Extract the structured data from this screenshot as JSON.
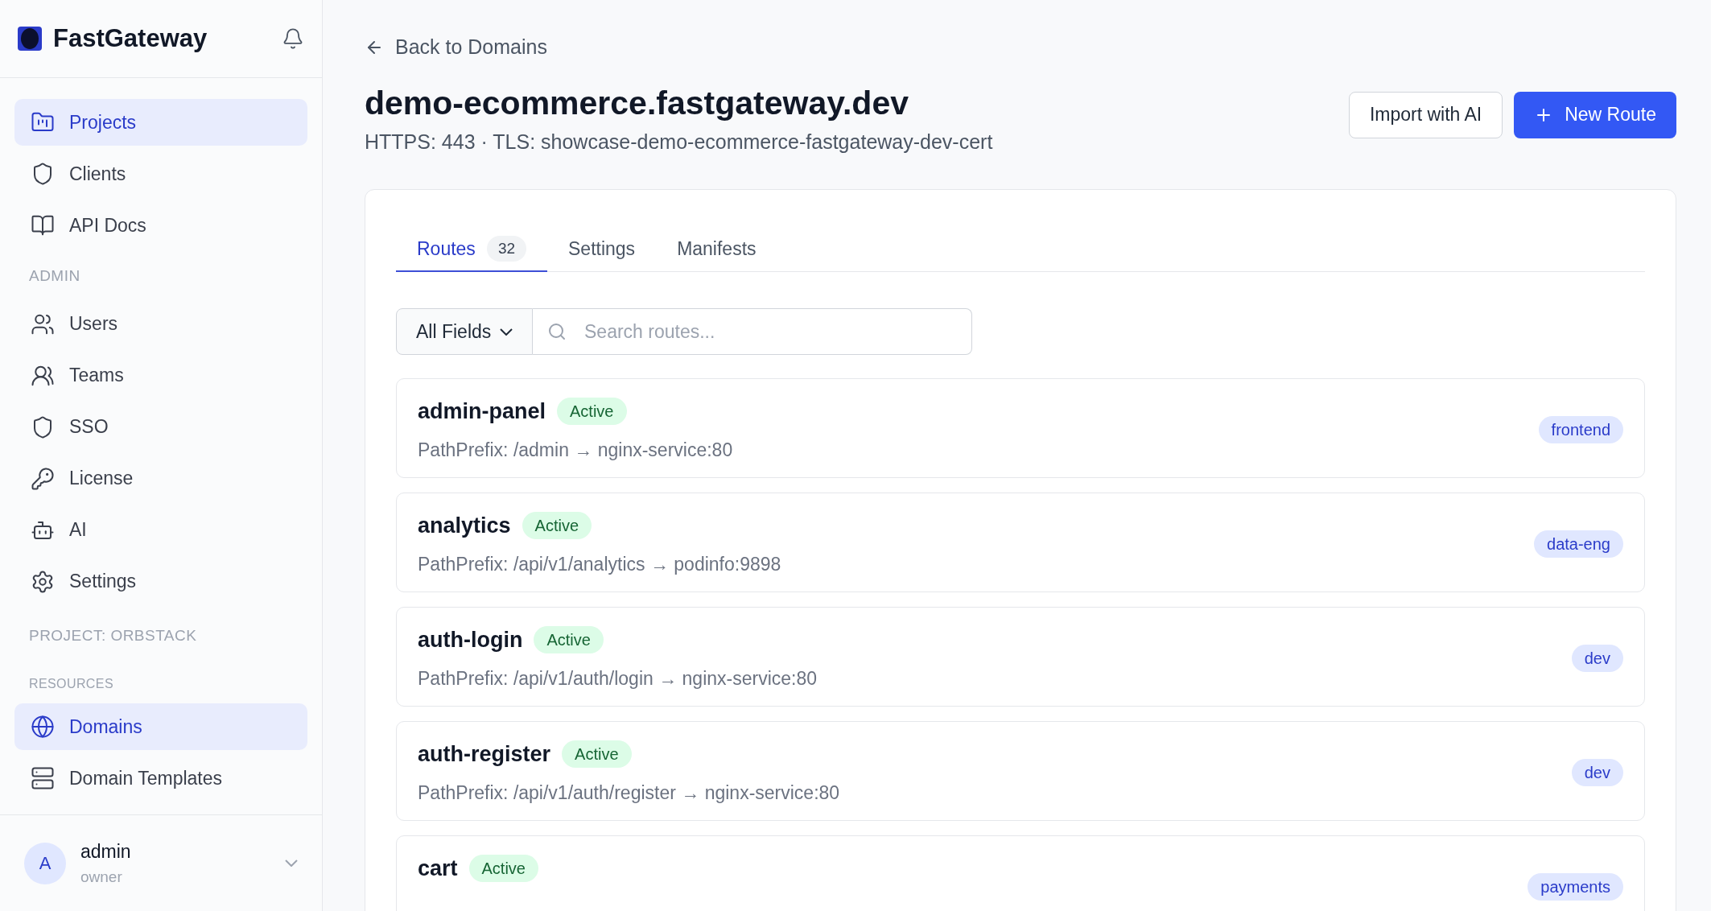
{
  "sidebar": {
    "brand": "FastGateway",
    "nav": [
      {
        "label": "Projects",
        "selected": true
      },
      {
        "label": "Clients",
        "selected": false
      },
      {
        "label": "API Docs",
        "selected": false
      }
    ],
    "admin": {
      "heading": "ADMIN",
      "items": [
        {
          "label": "Users",
          "selected": false
        },
        {
          "label": "Teams",
          "selected": false
        },
        {
          "label": "SSO",
          "selected": false
        },
        {
          "label": "License",
          "selected": false
        },
        {
          "label": "AI",
          "selected": false
        },
        {
          "label": "Settings",
          "selected": false
        }
      ]
    },
    "project": {
      "heading": "PROJECT: ORBSTACK",
      "subheading": "RESOURCES",
      "items": [
        {
          "label": "Domains",
          "selected": true
        },
        {
          "label": "Domain Templates",
          "selected": false
        }
      ]
    },
    "user": {
      "initial": "A",
      "name": "admin",
      "role": "owner"
    }
  },
  "back_link": "Back to Domains",
  "title": "demo-ecommerce.fastgateway.dev",
  "subtitle": "HTTPS: 443 · TLS: showcase-demo-ecommerce-fastgateway-dev-cert",
  "buttons": {
    "import": "Import with AI",
    "new": "New Route"
  },
  "tabs": [
    {
      "label": "Routes",
      "count": "32",
      "selected": true
    },
    {
      "label": "Settings",
      "selected": false
    },
    {
      "label": "Manifests",
      "selected": false
    }
  ],
  "filter": {
    "field": "All Fields",
    "placeholder": "Search routes..."
  },
  "routes": [
    {
      "name": "admin-panel",
      "status": "Active",
      "rule": "PathPrefix: /admin → nginx-service:80",
      "tag": "frontend"
    },
    {
      "name": "analytics",
      "status": "Active",
      "rule": "PathPrefix: /api/v1/analytics → podinfo:9898",
      "tag": "data-eng"
    },
    {
      "name": "auth-login",
      "status": "Active",
      "rule": "PathPrefix: /api/v1/auth/login → nginx-service:80",
      "tag": "dev"
    },
    {
      "name": "auth-register",
      "status": "Active",
      "rule": "PathPrefix: /api/v1/auth/register → nginx-service:80",
      "tag": "dev"
    },
    {
      "name": "cart",
      "status": "Active",
      "tag": "payments"
    }
  ]
}
